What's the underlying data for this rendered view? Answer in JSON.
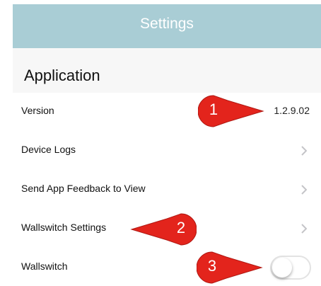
{
  "nav": {
    "title": "Settings"
  },
  "section": {
    "title": "Application"
  },
  "rows": [
    {
      "label": "Version",
      "value": "1.2.9.02"
    },
    {
      "label": "Device Logs"
    },
    {
      "label": "Send App Feedback to View"
    },
    {
      "label": "Wallswitch Settings"
    },
    {
      "label": "Wallswitch",
      "toggle_on": false
    }
  ],
  "callouts": [
    "1",
    "2",
    "3"
  ],
  "colors": {
    "nav_bg": "#a9cdd5",
    "callout": "#e3241c"
  }
}
